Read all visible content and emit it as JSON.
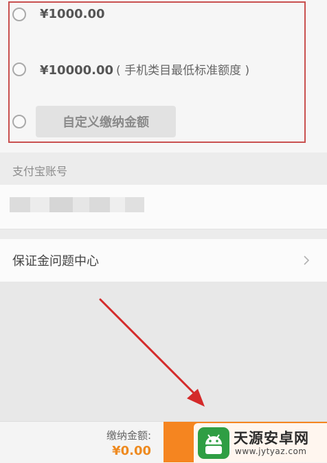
{
  "options": {
    "items": [
      {
        "amount": "¥1000.00",
        "note": ""
      },
      {
        "amount": "¥10000.00",
        "note": "( 手机类目最低标准额度 )"
      }
    ],
    "custom_label": "自定义缴纳金额"
  },
  "account": {
    "label": "支付宝账号",
    "value_masked_colors": [
      "#dcdcdc",
      "#ececec",
      "#d6d6d6",
      "#e6e6e6",
      "#dadada",
      "#eeeeee",
      "#e0e0e0"
    ]
  },
  "help": {
    "label": "保证金问题中心",
    "chevron_icon": "chevron-right-icon"
  },
  "footer": {
    "pay_label": "缴纳金额:",
    "pay_amount": "¥0.00",
    "submit_color": "#f58520"
  },
  "watermark": {
    "name": "天源安卓网",
    "url": "www.jytyaz.com",
    "logo_icon": "android-logo-icon"
  },
  "colors": {
    "highlight_border": "#c9504f",
    "arrow": "#d42a2a",
    "accent_orange": "#ee8a20"
  }
}
